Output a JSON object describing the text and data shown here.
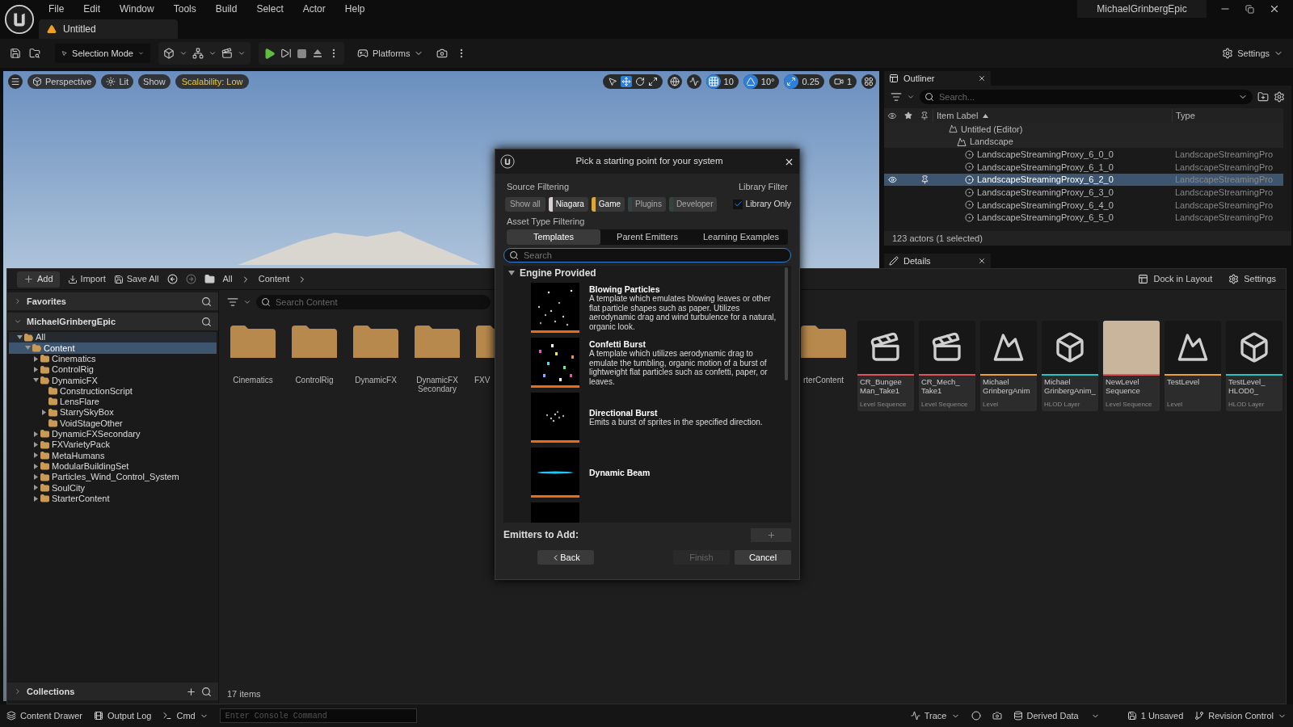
{
  "menu_bar": {
    "items": [
      "File",
      "Edit",
      "Window",
      "Tools",
      "Build",
      "Select",
      "Actor",
      "Help"
    ],
    "user": "MichaelGrinbergEpic"
  },
  "document_tab": {
    "title": "Untitled"
  },
  "toolbar": {
    "mode": "Selection Mode",
    "platforms": "Platforms",
    "settings": "Settings"
  },
  "viewport": {
    "buttons": [
      "Perspective",
      "Lit",
      "Show"
    ],
    "scalability": "Scalability: Low",
    "grid_snap": "10",
    "rotation_snap": "10°",
    "scale_snap": "0.25",
    "camera_speed": "1"
  },
  "outliner": {
    "title": "Outliner",
    "search_placeholder": "Search...",
    "columns": [
      "Item Label",
      "Type"
    ],
    "rows": [
      {
        "label": "Untitled (Editor)",
        "kind": "world",
        "selected": false,
        "children": [
          {
            "label": "Landscape",
            "kind": "landscape",
            "selected": false,
            "children": [
              {
                "label": "LandscapeStreamingProxy_6_0_0",
                "type": "LandscapeStreamingPro",
                "kind": "proxy",
                "selected": false
              },
              {
                "label": "LandscapeStreamingProxy_6_1_0",
                "type": "LandscapeStreamingPro",
                "kind": "proxy",
                "selected": false
              },
              {
                "label": "LandscapeStreamingProxy_6_2_0",
                "type": "LandscapeStreamingPro",
                "kind": "proxy",
                "selected": true
              },
              {
                "label": "LandscapeStreamingProxy_6_3_0",
                "type": "LandscapeStreamingPro",
                "kind": "proxy",
                "selected": false
              },
              {
                "label": "LandscapeStreamingProxy_6_4_0",
                "type": "LandscapeStreamingPro",
                "kind": "proxy",
                "selected": false
              },
              {
                "label": "LandscapeStreamingProxy_6_5_0",
                "type": "LandscapeStreamingPro",
                "kind": "proxy",
                "selected": false
              }
            ]
          }
        ]
      }
    ],
    "footer": "123 actors (1 selected)"
  },
  "details_tab": {
    "title": "Details"
  },
  "content_browser": {
    "add": "Add",
    "import": "Import",
    "save_all": "Save All",
    "path": [
      "All",
      "Content"
    ],
    "dock": "Dock in Layout",
    "settings": "Settings",
    "favorites": "Favorites",
    "project": "MichaelGrinbergEpic",
    "tree": [
      {
        "label": "All",
        "expandable": true,
        "expanded": true,
        "selected": false,
        "children": [
          {
            "label": "Content",
            "expandable": true,
            "expanded": true,
            "selected": true,
            "children": [
              {
                "label": "Cinematics",
                "expandable": true,
                "expanded": false,
                "selected": false
              },
              {
                "label": "ControlRig",
                "expandable": true,
                "expanded": false,
                "selected": false
              },
              {
                "label": "DynamicFX",
                "expandable": true,
                "expanded": true,
                "selected": false,
                "children": [
                  {
                    "label": "ConstructionScript",
                    "expandable": false,
                    "selected": false
                  },
                  {
                    "label": "LensFlare",
                    "expandable": false,
                    "selected": false
                  },
                  {
                    "label": "StarrySkyBox",
                    "expandable": true,
                    "expanded": false,
                    "selected": false
                  },
                  {
                    "label": "VoidStageOther",
                    "expandable": false,
                    "selected": false
                  }
                ]
              },
              {
                "label": "DynamicFXSecondary",
                "expandable": true,
                "expanded": false,
                "selected": false
              },
              {
                "label": "FXVarietyPack",
                "expandable": true,
                "expanded": false,
                "selected": false
              },
              {
                "label": "MetaHumans",
                "expandable": true,
                "expanded": false,
                "selected": false
              },
              {
                "label": "ModularBuildingSet",
                "expandable": true,
                "expanded": false,
                "selected": false
              },
              {
                "label": "Particles_Wind_Control_System",
                "expandable": true,
                "expanded": false,
                "selected": false
              },
              {
                "label": "SoulCity",
                "expandable": true,
                "expanded": false,
                "selected": false
              },
              {
                "label": "StarterContent",
                "expandable": true,
                "expanded": false,
                "selected": false
              }
            ]
          }
        ]
      }
    ],
    "collections": "Collections",
    "search_placeholder": "Search Content",
    "assets_left": [
      {
        "name": "Cinematics"
      },
      {
        "name": "ControlRig"
      },
      {
        "name": "DynamicFX"
      },
      {
        "name": "DynamicFX Secondary"
      },
      {
        "name": "FXV"
      }
    ],
    "assets_right": [
      {
        "name": "rterContent",
        "kind": "folder"
      },
      {
        "name": "CR_Bungee Man_Take1",
        "type": "Level Sequence",
        "kind": "sequence",
        "color": "#e0525a"
      },
      {
        "name": "CR_Mech_ Take1",
        "type": "Level Sequence",
        "kind": "sequence",
        "color": "#e0525a"
      },
      {
        "name": "Michael GrinbergAnim",
        "type": "Level",
        "kind": "level",
        "color": "#f0a028"
      },
      {
        "name": "Michael GrinbergAnim_",
        "type": "HLOD Layer",
        "kind": "hlod",
        "color": "#22c4c4"
      },
      {
        "name": "NewLevel Sequence",
        "type": "Level Sequence",
        "kind": "render",
        "color": "#e0525a"
      },
      {
        "name": "TestLevel",
        "type": "Level",
        "kind": "level",
        "color": "#f0a028"
      },
      {
        "name": "TestLevel_ HLOD0_",
        "type": "HLOD Layer",
        "kind": "hlod",
        "color": "#22c4c4"
      }
    ],
    "item_count": "17 items"
  },
  "dialog": {
    "title": "Pick a starting point for your system",
    "source_label": "Source Filtering",
    "library_label": "Library Filter",
    "sources": [
      {
        "label": "Show all",
        "kind": "all",
        "selected": false
      },
      {
        "label": "Niagara",
        "kind": "source",
        "color": "#d9cfcf",
        "selected": true
      },
      {
        "label": "Game",
        "kind": "source",
        "color": "#d9a838",
        "selected": true
      },
      {
        "label": "Plugins",
        "kind": "source",
        "color": "#2f4646",
        "selected": false
      },
      {
        "label": "Developer",
        "kind": "source",
        "color": "#34463c",
        "selected": false
      }
    ],
    "library_only": {
      "label": "Library Only",
      "checked": true
    },
    "asset_type_label": "Asset Type Filtering",
    "tabs": [
      {
        "label": "Templates",
        "selected": true
      },
      {
        "label": "Parent Emitters",
        "selected": false
      },
      {
        "label": "Learning Examples",
        "selected": false
      }
    ],
    "search_placeholder": "Search",
    "section": {
      "title": "Engine Provided",
      "expanded": true
    },
    "templates": [
      {
        "title": "Blowing Particles",
        "description": "A template which emulates blowing leaves or other flat particle shapes such as paper. Utilizes aerodynamic drag and wind turbulence for a natural, organic look.",
        "kind": "dust"
      },
      {
        "title": "Confetti Burst",
        "description": "A template which utilizes aerodynamic drag to emulate the tumbling, organic motion of a burst of lightweight flat particles such as confetti, paper, or leaves.",
        "kind": "confetti"
      },
      {
        "title": "Directional Burst",
        "description": "Emits a burst of sprites in the specified direction.",
        "kind": "burst"
      },
      {
        "title": "Dynamic Beam",
        "kind": "beam"
      },
      {
        "kind": "dark"
      }
    ],
    "emitters_label": "Emitters to Add:",
    "buttons": [
      {
        "label": "Back",
        "kind": "back",
        "disabled": false
      },
      {
        "label": "Finish",
        "kind": "plain",
        "disabled": true
      },
      {
        "label": "Cancel",
        "kind": "plain",
        "disabled": false
      }
    ]
  },
  "status_bar": {
    "content_drawer": "Content Drawer",
    "output_log": "Output Log",
    "cmd": "Cmd",
    "console_placeholder": "Enter Console Command",
    "trace": "Trace",
    "derived_data": "Derived Data",
    "unsaved": "1 Unsaved",
    "revision_control": "Revision Control"
  }
}
